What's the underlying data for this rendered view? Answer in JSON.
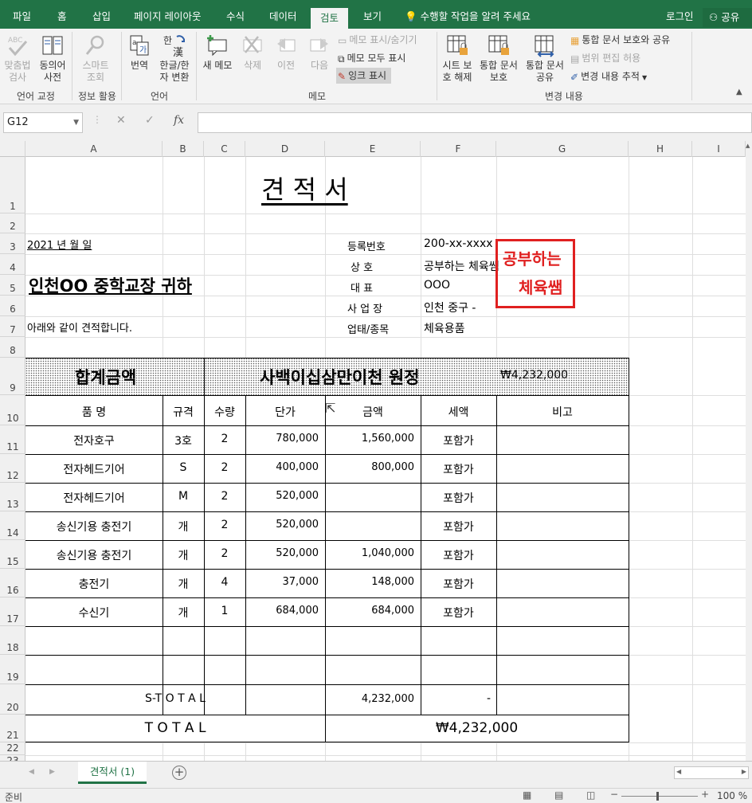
{
  "tabs": [
    {
      "label": "파일",
      "active": false
    },
    {
      "label": "홈",
      "active": false
    },
    {
      "label": "삽입",
      "active": false
    },
    {
      "label": "페이지 레이아웃",
      "active": false
    },
    {
      "label": "수식",
      "active": false
    },
    {
      "label": "데이터",
      "active": false
    },
    {
      "label": "검토",
      "active": true
    },
    {
      "label": "보기",
      "active": false
    }
  ],
  "tell_me": "수행할 작업을 알려 주세요",
  "login": "로그인",
  "share": "공유",
  "ribbon": {
    "spelling": {
      "l1": "맞춤법",
      "l2": "검사"
    },
    "thesaurus": {
      "l1": "동의어",
      "l2": "사전"
    },
    "smart_lookup": {
      "l1": "스마트",
      "l2": "조회"
    },
    "translate": "번역",
    "hangul_hanja": {
      "l1": "한글/한",
      "l2": "자 변환"
    },
    "new_comment": "새 메모",
    "delete": "삭제",
    "previous": "이전",
    "next": "다음",
    "show_hide_comment": "메모 표시/숨기기",
    "show_all_comments": "메모 모두 표시",
    "show_ink": "잉크 표시",
    "unprotect_sheet": {
      "l1": "시트 보",
      "l2": "호 해제"
    },
    "protect_workbook": {
      "l1": "통합 문서",
      "l2": "보호"
    },
    "share_workbook": {
      "l1": "통합 문서",
      "l2": "공유"
    },
    "protect_share": "통합 문서 보호와 공유",
    "allow_edit": "범위 편집 허용",
    "track_changes": "변경 내용 추적",
    "groups": {
      "proofing": "언어 교정",
      "insights": "정보 활용",
      "language": "언어",
      "comments": "메모",
      "changes": "변경 내용"
    }
  },
  "namebox": "G12",
  "columns": [
    "A",
    "B",
    "C",
    "D",
    "E",
    "F",
    "G",
    "H",
    "I"
  ],
  "rows": [
    "1",
    "2",
    "3",
    "4",
    "5",
    "6",
    "7",
    "8",
    "9",
    "10",
    "11",
    "12",
    "13",
    "14",
    "15",
    "16",
    "17",
    "18",
    "19",
    "20",
    "21",
    "22",
    "23"
  ],
  "sheet": {
    "title": "견  적  서",
    "date": "2021 년     월     일",
    "recipient": "인천OO 중학교장    귀하",
    "intro": "아래와 같이 견적합니다.",
    "supplier": [
      {
        "label": "등록번호",
        "value": "200-xx-xxxx"
      },
      {
        "label": "상       호",
        "value": "공부하는 체육쌤"
      },
      {
        "label": "대       표",
        "value": "OOO"
      },
      {
        "label": "사  업  장",
        "value": "인천 중구 -"
      },
      {
        "label": "업태/종목",
        "value": "체육용품"
      }
    ],
    "stamp": {
      "l1": "공부하는",
      "l2": "체육쌤"
    },
    "total_label": "합계금액",
    "total_words": "사백이십삼만이천 원정",
    "total_amount": "₩4,232,000",
    "headers": {
      "name": "품    명",
      "spec": "규격",
      "qty": "수량",
      "unit": "단가",
      "amount": "금액",
      "tax": "세액",
      "note": "비고"
    },
    "items": [
      {
        "name": "전자호구",
        "spec": "3호",
        "qty": "2",
        "unit": "780,000",
        "amount": "1,560,000",
        "tax": "포함가"
      },
      {
        "name": "전자헤드기어",
        "spec": "S",
        "qty": "2",
        "unit": "400,000",
        "amount": "800,000",
        "tax": "포함가"
      },
      {
        "name": "전자헤드기어",
        "spec": "M",
        "qty": "2",
        "unit": "520,000",
        "amount": "",
        "tax": "포함가"
      },
      {
        "name": "송신기용 충전기",
        "spec": "개",
        "qty": "2",
        "unit": "520,000",
        "amount": "",
        "tax": "포함가"
      },
      {
        "name": "송신기용 충전기",
        "spec": "개",
        "qty": "2",
        "unit": "520,000",
        "amount": "1,040,000",
        "tax": "포함가"
      },
      {
        "name": "충전기",
        "spec": "개",
        "qty": "4",
        "unit": "37,000",
        "amount": "148,000",
        "tax": "포함가"
      },
      {
        "name": "수신기",
        "spec": "개",
        "qty": "1",
        "unit": "684,000",
        "amount": "684,000",
        "tax": "포함가"
      }
    ],
    "subtotal_label": "S-T O T A L",
    "subtotal_amount": "4,232,000",
    "subtotal_tax": "-",
    "grand_label": "T   O   T   A   L",
    "grand_amount": "₩4,232,000"
  },
  "sheet_tab": "견적서 (1)",
  "status": {
    "ready": "준비",
    "zoom": "100 %"
  }
}
